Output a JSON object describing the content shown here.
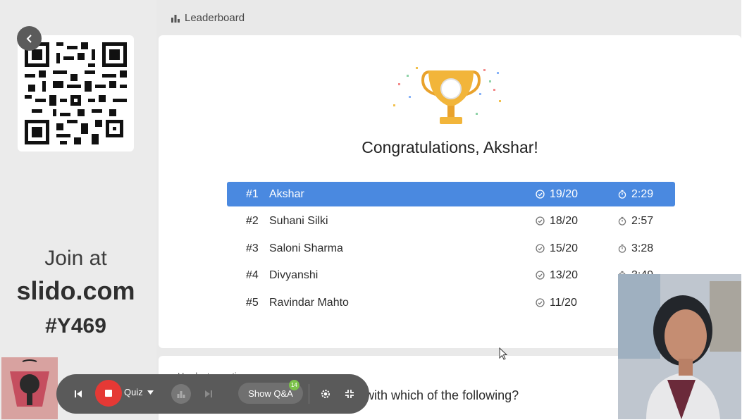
{
  "header": {
    "title": "Leaderboard",
    "icon": "leaderboard-icon"
  },
  "left_panel": {
    "join_text": "Join at",
    "site": "slido.com",
    "code": "#Y469"
  },
  "congrats": "Congratulations, Akshar!",
  "leaderboard": [
    {
      "rank": "#1",
      "name": "Akshar",
      "score": "19/20",
      "time": "2:29"
    },
    {
      "rank": "#2",
      "name": "Suhani Silki",
      "score": "18/20",
      "time": "2:57"
    },
    {
      "rank": "#3",
      "name": "Saloni Sharma",
      "score": "15/20",
      "time": "3:28"
    },
    {
      "rank": "#4",
      "name": "Divyanshi",
      "score": "13/20",
      "time": "3:49"
    },
    {
      "rank": "#5",
      "name": "Ravindar Mahto",
      "score": "11/20",
      "time": ""
    }
  ],
  "hardest": {
    "label": "Hardest question",
    "question": "with which of the following?"
  },
  "toolbar": {
    "quiz_label": "Quiz",
    "qa_label": "Show Q&A",
    "qa_badge": "14"
  },
  "colors": {
    "highlight": "#4a89e0",
    "stop": "#e53935",
    "trophy": "#f2b53a",
    "badge": "#7cc24a"
  }
}
